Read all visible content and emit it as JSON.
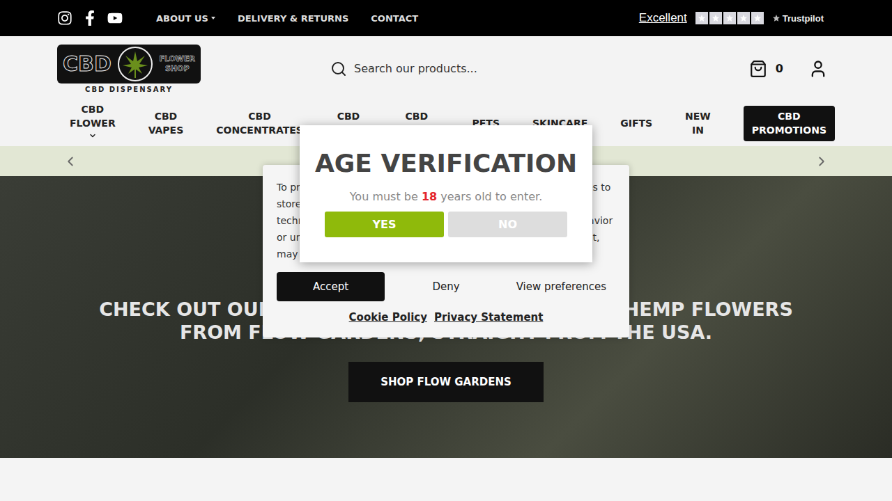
{
  "top_bar": {
    "nav": [
      {
        "label": "ABOUT US",
        "dropdown": true
      },
      {
        "label": "DELIVERY & RETURNS",
        "dropdown": false
      },
      {
        "label": "CONTACT",
        "dropdown": false
      }
    ],
    "trustpilot": {
      "rating": "Excellent",
      "stars": 5,
      "brand": "Trustpilot"
    }
  },
  "logo": {
    "big": "CBD",
    "top": "FLOWER",
    "bottom": "SHOP",
    "tagline": "CBD DISPENSARY"
  },
  "search": {
    "placeholder": "Search our products..."
  },
  "cart": {
    "count": "0"
  },
  "main_nav": [
    {
      "label": "CBD FLOWER",
      "dropdown": true,
      "highlighted": false
    },
    {
      "label": "CBD VAPES",
      "dropdown": false,
      "highlighted": false
    },
    {
      "label": "CBD CONCENTRATES",
      "dropdown": false,
      "highlighted": false
    },
    {
      "label": "CBD OILS",
      "dropdown": false,
      "highlighted": false
    },
    {
      "label": "CBD EDIBLES",
      "dropdown": false,
      "highlighted": false
    },
    {
      "label": "PETS",
      "dropdown": false,
      "highlighted": false
    },
    {
      "label": "SKINCARE",
      "dropdown": false,
      "highlighted": false
    },
    {
      "label": "GIFTS",
      "dropdown": false,
      "highlighted": false
    },
    {
      "label": "NEW IN",
      "dropdown": false,
      "highlighted": false
    },
    {
      "label": "CBD PROMOTIONS",
      "dropdown": false,
      "highlighted": true
    }
  ],
  "promo_strip": {
    "text": "FREE DELIVERY ON ALL UK ORDERS OVER £100"
  },
  "hero": {
    "heading": "CHECK OUT OUR EXCLUSIVE RANGE OF PREMIUM HEMP FLOWERS FROM FLOW GARDENS, STRAIGHT FROM THE USA.",
    "button": "SHOP FLOW GARDENS"
  },
  "cookie_banner": {
    "text": "To provide the best experiences, we use technologies like cookies to store and/or access device information. Consenting to these technologies will allow us to process data such as browsing behavior or unique IDs on this site. Not consenting or withdrawing consent, may adversely affect certain features and functions.",
    "buttons": [
      "Accept",
      "Deny",
      "View preferences"
    ],
    "links": [
      "Cookie Policy",
      "Privacy Statement"
    ]
  },
  "age_modal": {
    "title": "AGE VERIFICATION",
    "text_before": "You must be ",
    "age": "18",
    "text_after": " years old to enter.",
    "buttons": [
      {
        "label": "YES",
        "primary": true
      },
      {
        "label": "NO",
        "primary": false
      }
    ]
  }
}
